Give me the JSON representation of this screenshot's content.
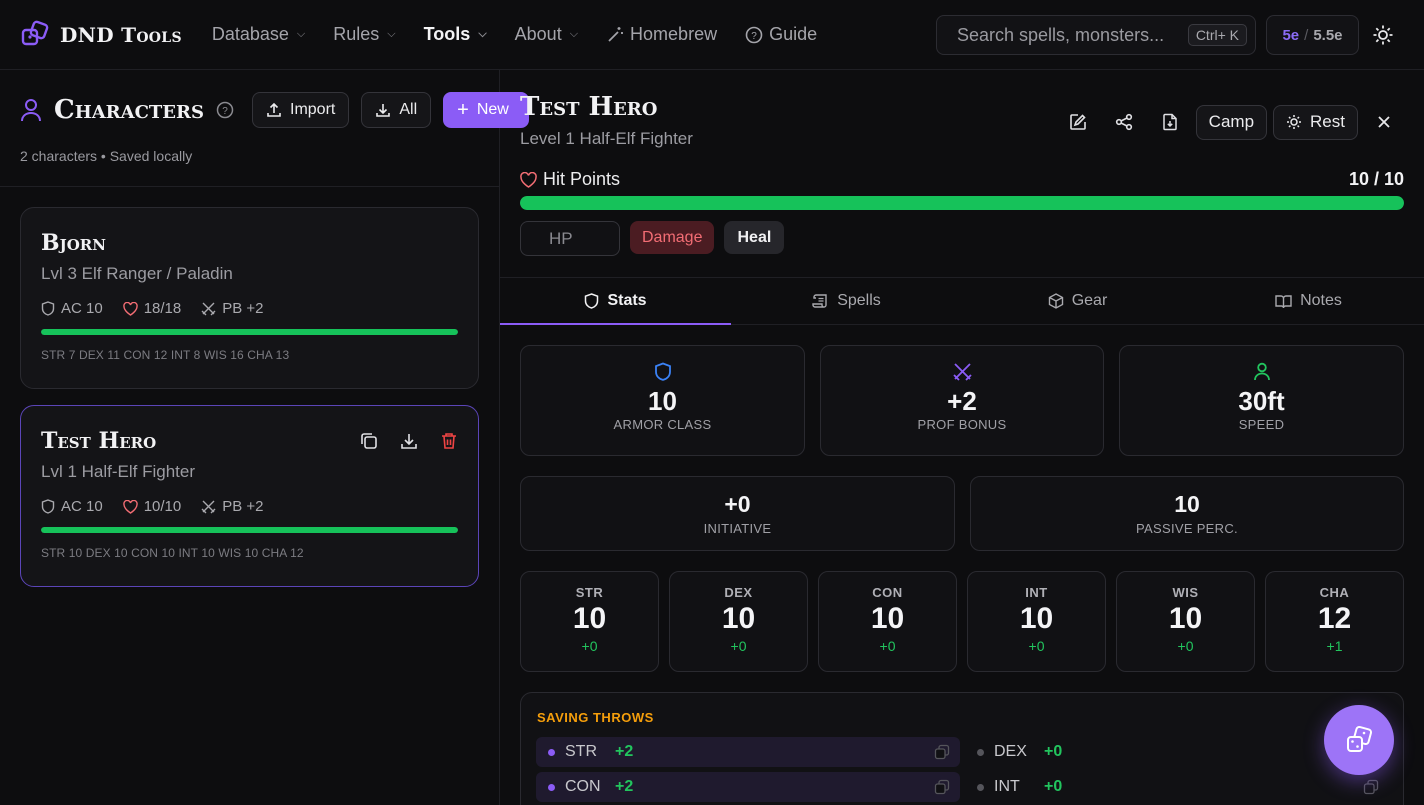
{
  "nav": {
    "logo": "DND Tools",
    "items": [
      {
        "label": "Database",
        "has_menu": true,
        "active": false
      },
      {
        "label": "Rules",
        "has_menu": true,
        "active": false
      },
      {
        "label": "Tools",
        "has_menu": true,
        "active": true
      },
      {
        "label": "About",
        "has_menu": true,
        "active": false
      }
    ],
    "homebrew": "Homebrew",
    "guide": "Guide",
    "search_placeholder": "Search spells, monsters...",
    "search_shortcut": "Ctrl+ K",
    "edition_a": "5e",
    "edition_sep": "/",
    "edition_b": "5.5e"
  },
  "characters": {
    "title": "Characters",
    "import_label": "Import",
    "all_label": "All",
    "new_label": "New",
    "subtitle": "2 characters • Saved locally",
    "list": [
      {
        "name": "Bjorn",
        "sub": "Lvl 3 Elf Ranger / Paladin",
        "ac": "AC 10",
        "hp": "18/18",
        "pb": "PB +2",
        "hp_fraction": 1.0,
        "abilities": "STR 7 DEX 11 CON 12 INT 8 WIS 16 CHA 13"
      },
      {
        "name": "Test Hero",
        "sub": "Lvl 1 Half-Elf Fighter",
        "ac": "AC 10",
        "hp": "10/10",
        "pb": "PB +2",
        "hp_fraction": 1.0,
        "abilities": "STR 10 DEX 10 CON 10 INT 10 WIS 10 CHA 12"
      }
    ]
  },
  "hero": {
    "name": "Test Hero",
    "sub": "Level 1 Half-Elf Fighter",
    "camp_label": "Camp",
    "rest_label": "Rest",
    "hp_label": "Hit Points",
    "hp_value": "10 / 10",
    "hp_fraction": 1.0,
    "hp_placeholder": "HP",
    "damage_label": "Damage",
    "heal_label": "Heal"
  },
  "tabs": [
    {
      "label": "Stats",
      "icon": "shield-icon",
      "active": true
    },
    {
      "label": "Spells",
      "icon": "scroll-icon",
      "active": false
    },
    {
      "label": "Gear",
      "icon": "box-icon",
      "active": false
    },
    {
      "label": "Notes",
      "icon": "book-icon",
      "active": false
    }
  ],
  "stats": {
    "ac": {
      "value": "10",
      "label": "ARMOR CLASS"
    },
    "prof": {
      "value": "+2",
      "label": "PROF BONUS"
    },
    "speed": {
      "value": "30ft",
      "label": "SPEED"
    },
    "initiative": {
      "value": "+0",
      "label": "INITIATIVE"
    },
    "passive": {
      "value": "10",
      "label": "PASSIVE PERC."
    }
  },
  "abilities": [
    {
      "name": "STR",
      "score": "10",
      "mod": "+0"
    },
    {
      "name": "DEX",
      "score": "10",
      "mod": "+0"
    },
    {
      "name": "CON",
      "score": "10",
      "mod": "+0"
    },
    {
      "name": "INT",
      "score": "10",
      "mod": "+0"
    },
    {
      "name": "WIS",
      "score": "10",
      "mod": "+0"
    },
    {
      "name": "CHA",
      "score": "12",
      "mod": "+1"
    }
  ],
  "saves": {
    "title": "SAVING THROWS",
    "rows": [
      {
        "name": "STR",
        "value": "+2",
        "proficient": true
      },
      {
        "name": "DEX",
        "value": "+0",
        "proficient": false
      },
      {
        "name": "CON",
        "value": "+2",
        "proficient": true
      },
      {
        "name": "INT",
        "value": "+0",
        "proficient": false
      }
    ]
  },
  "colors": {
    "accent": "#8b5cf6",
    "hp_green": "#16c25a",
    "mod_green": "#22c55e",
    "danger": "#f26d74",
    "saves_title": "#f59e0b"
  }
}
